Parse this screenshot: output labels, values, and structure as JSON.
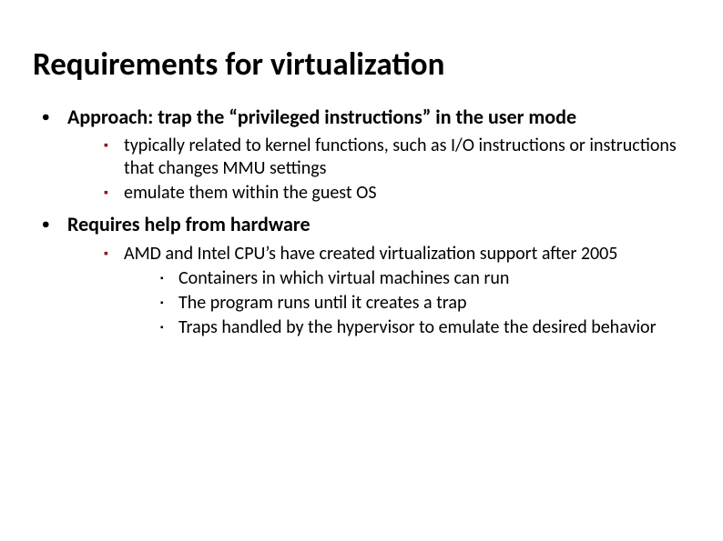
{
  "title": "Requirements for virtualization",
  "bullets": [
    {
      "text": "Approach: trap the “privileged instructions” in the user mode",
      "children": [
        {
          "text": "typically related to kernel functions, such as I/O instructions or instructions that changes MMU settings"
        },
        {
          "text": "emulate them within the guest OS"
        }
      ]
    },
    {
      "text": "Requires help from hardware",
      "children": [
        {
          "text": "AMD and Intel CPU’s have created virtualization support after 2005",
          "children": [
            {
              "text": "Containers in which virtual machines can run"
            },
            {
              "text": "The program runs until it creates a trap"
            },
            {
              "text": "Traps handled by the hypervisor to emulate the desired behavior"
            }
          ]
        }
      ]
    }
  ]
}
